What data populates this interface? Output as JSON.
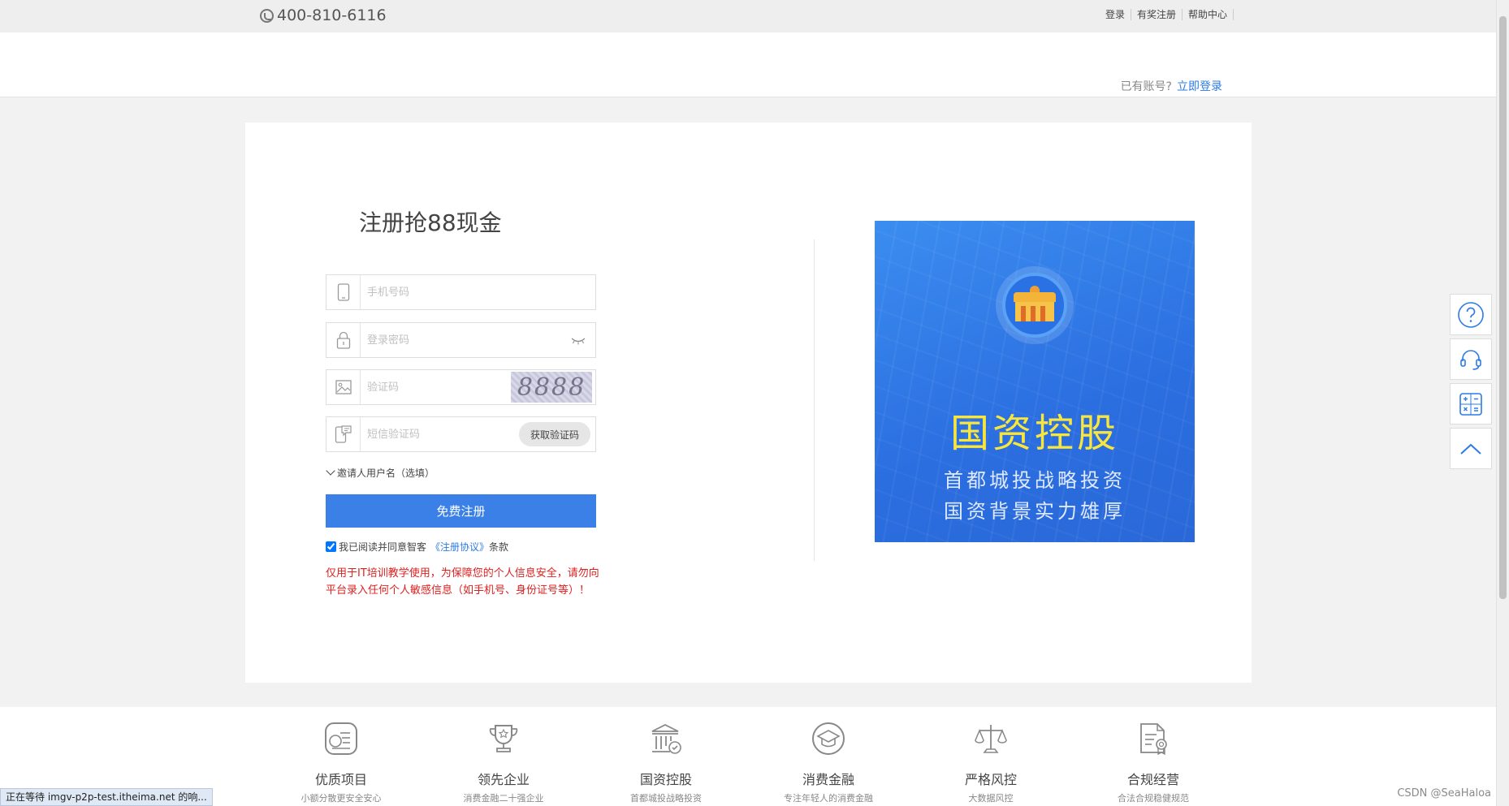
{
  "topbar": {
    "phone": "400-810-6116",
    "links": [
      "登录",
      "有奖注册",
      "帮助中心"
    ]
  },
  "header": {
    "has_account": "已有账号?",
    "login_now": "立即登录"
  },
  "form": {
    "title": "注册抢88现金",
    "phone_placeholder": "手机号码",
    "password_placeholder": "登录密码",
    "captcha_placeholder": "验证码",
    "captcha_text": "8888",
    "sms_placeholder": "短信验证码",
    "sms_button": "获取验证码",
    "invite": "邀请人用户名（选填）",
    "register_button": "免费注册",
    "agree_prefix": "我已阅读并同意智客",
    "agreement_link": "《注册协议》",
    "agree_suffix": "条款",
    "agree_checked": true,
    "warning": "仅用于IT培训教学使用，为保障您的个人信息安全，请勿向平台录入任何个人敏感信息（如手机号、身份证号等）！"
  },
  "banner": {
    "title": "国资控股",
    "line1": "首都城投战略投资",
    "line2": "国资背景实力雄厚"
  },
  "features": [
    {
      "title": "优质项目",
      "subtitle": "小额分散更安全安心",
      "icon": "coin-list-icon"
    },
    {
      "title": "领先企业",
      "subtitle": "消费金融二十强企业",
      "icon": "trophy-icon"
    },
    {
      "title": "国资控股",
      "subtitle": "首都城投战略投资",
      "icon": "bank-icon"
    },
    {
      "title": "消费金融",
      "subtitle": "专注年轻人的消费金融",
      "icon": "graduate-cap-icon"
    },
    {
      "title": "严格风控",
      "subtitle": "大数据风控",
      "icon": "scale-icon"
    },
    {
      "title": "合规经营",
      "subtitle": "合法合规稳健规范",
      "icon": "document-seal-icon"
    }
  ],
  "status_bar": "正在等待 imgv-p2p-test.itheima.net 的响...",
  "watermark": "CSDN @SeaHaloa",
  "colors": {
    "accent": "#3a80e6",
    "link": "#2d7be5",
    "warning": "#e01e1e",
    "banner_title": "#f8e63c"
  }
}
